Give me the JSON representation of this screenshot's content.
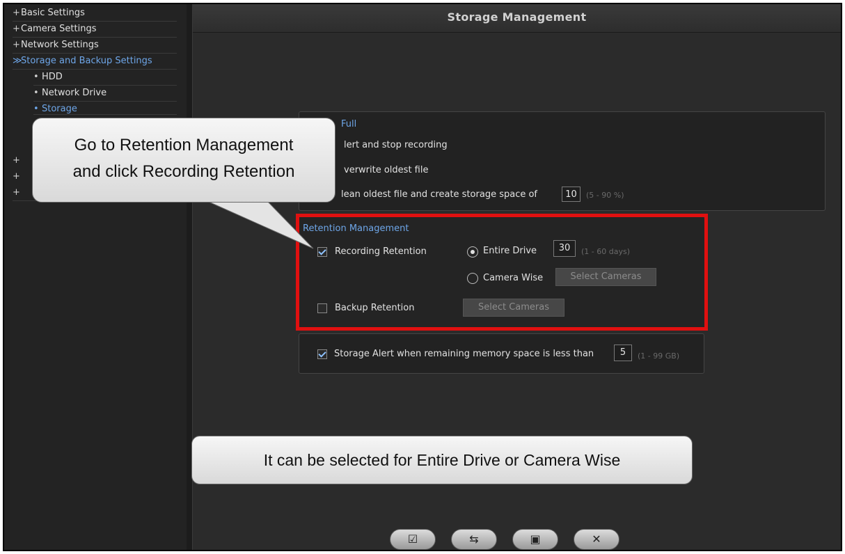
{
  "sidebar": {
    "items": [
      {
        "prefix": "+",
        "label": "Basic Settings"
      },
      {
        "prefix": "+",
        "label": "Camera Settings"
      },
      {
        "prefix": "+",
        "label": "Network Settings"
      },
      {
        "prefix": "≫",
        "label": "Storage and Backup Settings"
      }
    ],
    "subitems": [
      {
        "prefix": "•",
        "label": "HDD"
      },
      {
        "prefix": "•",
        "label": "Network Drive"
      },
      {
        "prefix": "•",
        "label": "Storage"
      }
    ],
    "collapsed_prefixes": [
      "+",
      "+",
      "+"
    ]
  },
  "header": {
    "title": "Storage Management"
  },
  "storage_full": {
    "title_partial": "Full",
    "option1": "lert and stop recording",
    "option2": "verwrite oldest file",
    "option3": "lean oldest file and create storage space of",
    "space_value": "10",
    "space_hint": "(5 - 90 %)"
  },
  "retention": {
    "title": "Retention Management",
    "recording_label": "Recording Retention",
    "recording_checked": true,
    "entire_drive_label": "Entire Drive",
    "days_value": "30",
    "days_hint": "(1 - 60 days)",
    "camera_wise_label": "Camera Wise",
    "select_cameras_label": "Select Cameras",
    "backup_label": "Backup Retention",
    "backup_checked": false,
    "backup_select_cameras_label": "Select Cameras"
  },
  "storage_alert": {
    "label": "Storage Alert when remaining memory space is less than",
    "checked": true,
    "value": "5",
    "hint": "(1 - 99 GB)"
  },
  "callouts": {
    "top_line1": "Go to Retention Management",
    "top_line2": "and click Recording Retention",
    "bottom": "It can be selected for Entire Drive or Camera Wise"
  },
  "toolbar": {
    "apply_icon": "apply-check-icon",
    "refresh_icon": "refresh-icon",
    "save_icon": "save-icon",
    "close_icon": "close-icon",
    "apply_glyph": "☑",
    "refresh_glyph": "⇆",
    "save_glyph": "▣",
    "close_glyph": "✕"
  },
  "colors": {
    "accent_blue": "#6ea6e8",
    "highlight_red": "#e01010",
    "background": "#2b2b2b"
  }
}
